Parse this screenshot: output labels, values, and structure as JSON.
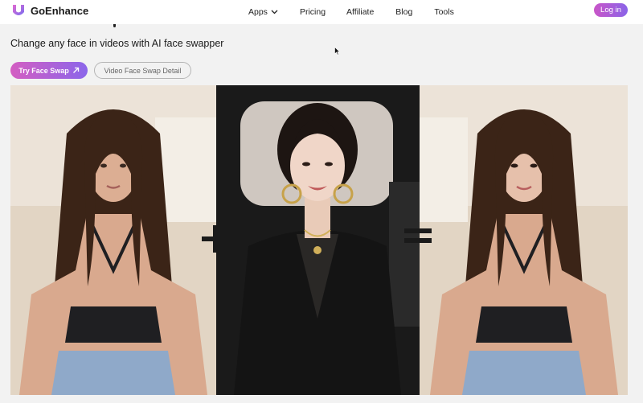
{
  "header": {
    "logo_text": "GoEnhance",
    "nav": [
      {
        "label": "Apps"
      },
      {
        "label": "Pricing"
      },
      {
        "label": "Affiliate"
      },
      {
        "label": "Blog"
      },
      {
        "label": "Tools"
      }
    ],
    "login_label": "Log in"
  },
  "hero": {
    "subtitle": "Change any face in videos with AI face swapper",
    "primary_button": "Try Face Swap",
    "secondary_button": "Video Face Swap Detail"
  },
  "colors": {
    "accent_start": "#d45ec2",
    "accent_end": "#8b66ea",
    "page_background": "#f2f2f2"
  },
  "icons": {
    "logo": "goenhance-logo-icon",
    "apps_dropdown": "chevron-down-icon",
    "primary_button": "arrow-up-right-icon",
    "plus": "plus-icon",
    "equals": "equals-icon"
  }
}
